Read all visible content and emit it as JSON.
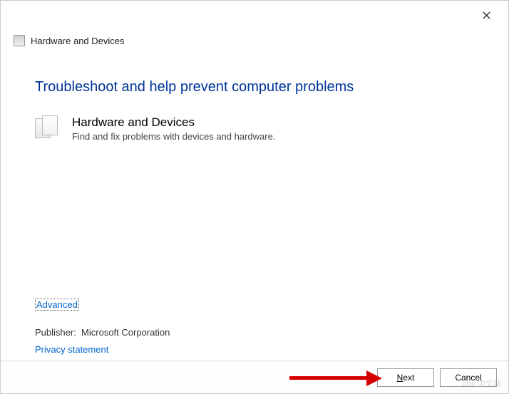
{
  "window": {
    "title": "Hardware and Devices"
  },
  "content": {
    "heading": "Troubleshoot and help prevent computer problems",
    "item": {
      "title": "Hardware and Devices",
      "description": "Find and fix problems with devices and hardware."
    }
  },
  "links": {
    "advanced": "Advanced",
    "publisher_label": "Publisher:",
    "publisher_value": "Microsoft Corporation",
    "privacy": "Privacy statement"
  },
  "footer": {
    "next_prefix": "N",
    "next_rest": "ext",
    "cancel": "Cancel"
  },
  "watermark": "php 中文网"
}
